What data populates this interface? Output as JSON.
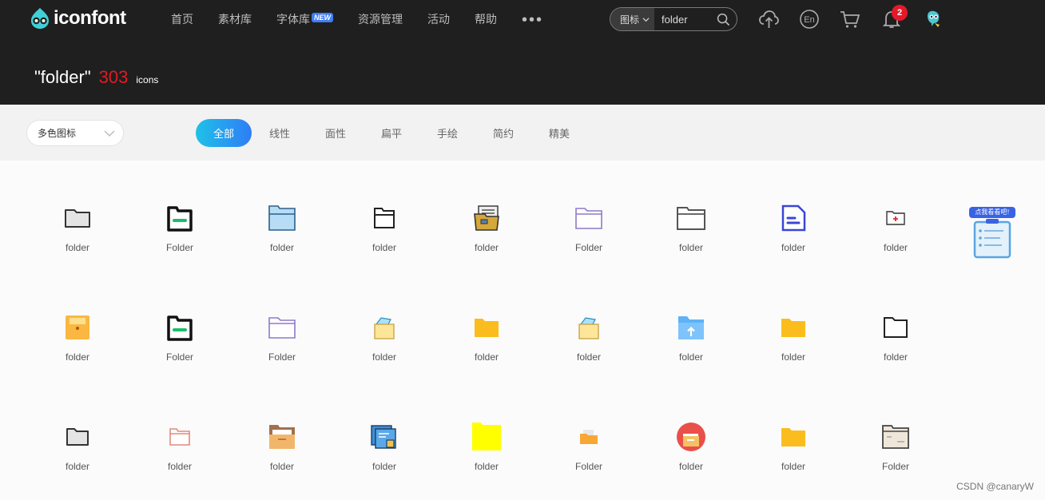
{
  "topbar": {
    "logo_text": "iconfont",
    "nav": [
      "首页",
      "素材库",
      "字体库",
      "资源管理",
      "活动",
      "帮助"
    ],
    "new_badge": "NEW",
    "more_dots": "•••",
    "search": {
      "type_label": "图标",
      "query": "folder"
    },
    "notification_count": "2",
    "icons": [
      "upload-icon",
      "language-en-icon",
      "cart-icon",
      "bell-icon",
      "avatar"
    ]
  },
  "header": {
    "query": "\"folder\"",
    "count": "303",
    "unit": "icons"
  },
  "filters": {
    "color_select": "多色图标",
    "tabs": [
      "全部",
      "线性",
      "面性",
      "扁平",
      "手绘",
      "简约",
      "精美"
    ],
    "active_tab": "全部"
  },
  "grid": {
    "rows": [
      [
        "folder",
        "Folder",
        "folder",
        "folder",
        "folder",
        "Folder",
        "folder",
        "folder",
        "folder"
      ],
      [
        "folder",
        "Folder",
        "Folder",
        "folder",
        "folder",
        "folder",
        "folder",
        "folder",
        "folder"
      ],
      [
        "folder",
        "folder",
        "folder",
        "folder",
        "folder",
        "Folder",
        "folder",
        "folder",
        "Folder"
      ]
    ]
  },
  "promo": {
    "label": "点我看看吧!"
  },
  "watermark": "CSDN @canaryW",
  "colors": {
    "accent_start": "#1fc1e8",
    "accent_end": "#2f7df6",
    "count_red": "#e01b24",
    "bg_dark": "#1f1f1f"
  }
}
